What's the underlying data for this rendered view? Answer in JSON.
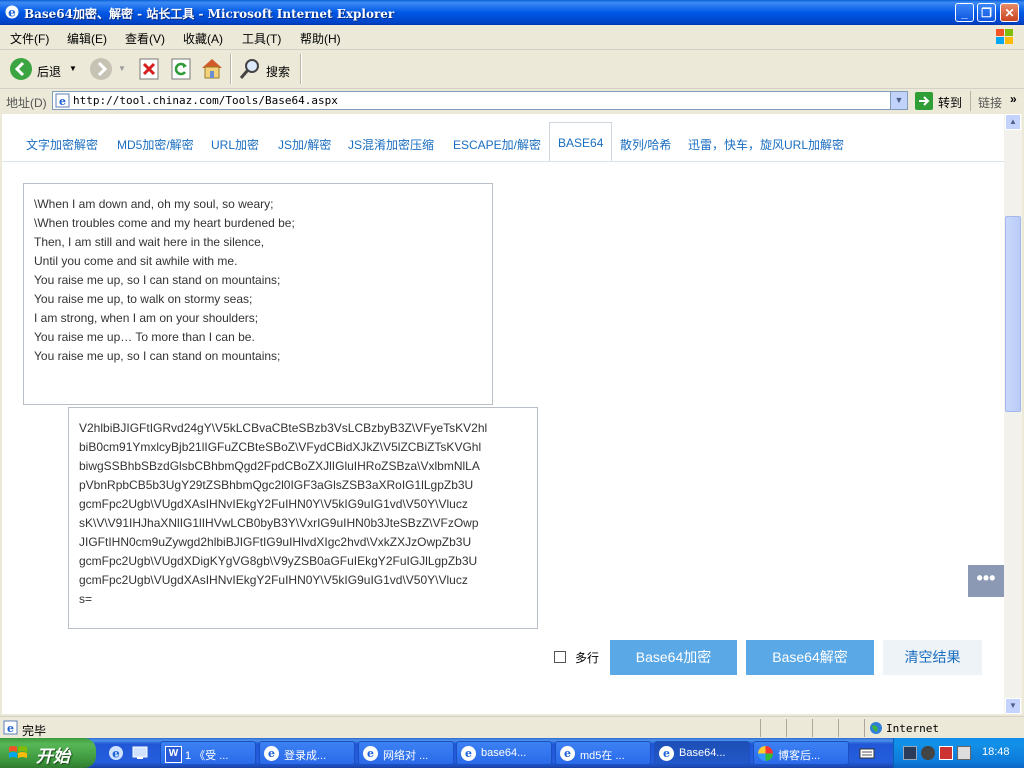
{
  "window": {
    "title": "Base64加密、解密 - 站长工具 - Microsoft Internet Explorer",
    "minimize_glyph": "_",
    "maximize_glyph": "❐",
    "close_glyph": "✕"
  },
  "menu": {
    "items": [
      "文件(F)",
      "编辑(E)",
      "查看(V)",
      "收藏(A)",
      "工具(T)",
      "帮助(H)"
    ]
  },
  "toolbar": {
    "back_label": "后退",
    "search_label": "搜索"
  },
  "address": {
    "label": "地址(D)",
    "url": "http://tool.chinaz.com/Tools/Base64.aspx",
    "go_label": "转到",
    "links_label": "链接",
    "overflow": "»"
  },
  "tabs": [
    {
      "label": "文字加密解密",
      "active": false
    },
    {
      "label": "MD5加密/解密",
      "active": false
    },
    {
      "label": "URL加密",
      "active": false
    },
    {
      "label": "JS加/解密",
      "active": false
    },
    {
      "label": "JS混淆加密压缩",
      "active": false
    },
    {
      "label": "ESCAPE加/解密",
      "active": false
    },
    {
      "label": "BASE64",
      "active": true
    },
    {
      "label": "散列/哈希",
      "active": false
    },
    {
      "label": "迅雷，快车，旋风URL加解密",
      "active": false
    }
  ],
  "input": {
    "lines": [
      "\\When I am down and, oh my soul, so weary;",
      "\\When troubles come and my heart burdened be;",
      "Then, I am still and wait here in the silence,",
      "Until you come and sit awhile with me.",
      "You raise me up, so I can stand on mountains;",
      "You raise me up, to walk on stormy seas;",
      "I am strong, when I am on your shoulders;",
      "You raise me up… To more than I can be.",
      "You raise me up, so I can stand on mountains;"
    ]
  },
  "output": {
    "lines": [
      "V2hlbiBJIGFtIGRvd24gY\\V5kLCBvaCBteSBzb3VsLCBzbyB3Z\\VFyeTsKV2hl",
      "biB0cm91YmxlcyBjb21lIGFuZCBteSBoZ\\VFydCBidXJkZ\\V5lZCBiZTsKVGhl",
      "biwgSSBhbSBzdGlsbCBhbmQgd2FpdCBoZXJlIGluIHRoZSBza\\VxlbmNlLA",
      "pVbnRpbCB5b3UgY29tZSBhbmQgc2l0IGF3aGlsZSB3aXRoIG1lLgpZb3U",
      "gcmFpc2Ugb\\VUgdXAsIHNvIEkgY2FuIHN0Y\\V5kIG9uIG1vd\\V50Y\\Vlucz",
      "sK\\V\\V91IHJhaXNlIG1lIHVwLCB0byB3Y\\VxrIG9uIHN0b3JteSBzZ\\VFzOwp",
      "JIGFtIHN0cm9uZywgd2hlbiBJIGFtIG9uIHlvdXIgc2hvd\\VxkZXJzOwpZb3U",
      "gcmFpc2Ugb\\VUgdXDigKYgVG8gb\\V9yZSB0aGFuIEkgY2FuIGJlLgpZb3U",
      "gcmFpc2Ugb\\VUgdXAsIHNvIEkgY2FuIHN0Y\\V5kIG9uIG1vd\\V50Y\\Vlucz",
      "s="
    ]
  },
  "controls": {
    "multiline_label": "多行",
    "multiline_checked": false,
    "encode_label": "Base64加密",
    "decode_label": "Base64解密",
    "clear_label": "清空结果",
    "more_glyph": "•••"
  },
  "status": {
    "text": "完毕",
    "zone": "Internet"
  },
  "taskbar": {
    "start_label": "开始",
    "tasks": [
      {
        "label": "1 《受 ...",
        "active": false
      },
      {
        "label": "登录成...",
        "active": false
      },
      {
        "label": "网络对 ...",
        "active": false
      },
      {
        "label": "base64...",
        "active": false
      },
      {
        "label": "md5在 ...",
        "active": false
      },
      {
        "label": "Base64...",
        "active": true
      },
      {
        "label": "博客后...",
        "active": false
      }
    ],
    "clock": "18:48"
  },
  "colors": {
    "accent": "#1a6ec0",
    "button_blue": "#5aa8e6",
    "taskbar": "#245edc"
  }
}
